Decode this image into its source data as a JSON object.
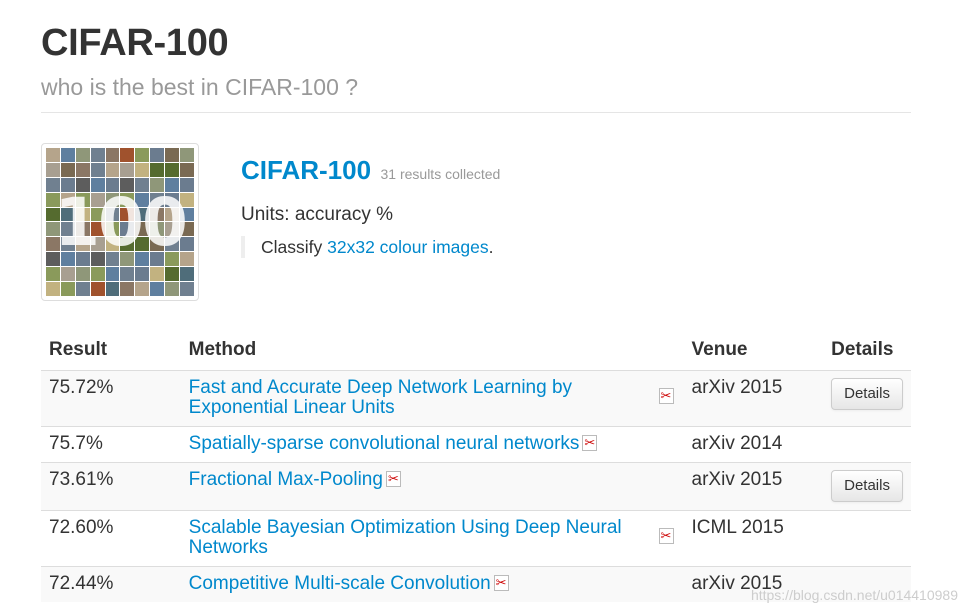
{
  "header": {
    "title": "CIFAR-100",
    "subtitle": "who is the best in CIFAR-100 ?"
  },
  "dataset": {
    "thumbnail_text": "100",
    "name": "CIFAR-100",
    "count": "31 results collected",
    "units": "Units: accuracy %",
    "desc_prefix": "Classify ",
    "desc_link": "32x32 colour images",
    "desc_suffix": "."
  },
  "table": {
    "headers": {
      "result": "Result",
      "method": "Method",
      "venue": "Venue",
      "details": "Details"
    },
    "rows": [
      {
        "result": "75.72%",
        "method": "Fast and Accurate Deep Network Learning by Exponential Linear Units",
        "venue": "arXiv 2015",
        "details": "Details"
      },
      {
        "result": "75.7%",
        "method": "Spatially-sparse convolutional neural networks",
        "venue": "arXiv 2014",
        "details": ""
      },
      {
        "result": "73.61%",
        "method": "Fractional Max-Pooling",
        "venue": "arXiv 2015",
        "details": "Details"
      },
      {
        "result": "72.60%",
        "method": "Scalable Bayesian Optimization Using Deep Neural Networks",
        "venue": "ICML 2015",
        "details": ""
      },
      {
        "result": "72.44%",
        "method": "Competitive Multi-scale Convolution",
        "venue": "arXiv 2015",
        "details": ""
      }
    ]
  },
  "watermark": "https://blog.csdn.net/u014410989",
  "colors": {
    "link": "#0088cc",
    "text": "#333333",
    "muted": "#999999",
    "row_stripe": "#f9f9f9"
  },
  "icons": {
    "pdf": "pdf-icon"
  }
}
